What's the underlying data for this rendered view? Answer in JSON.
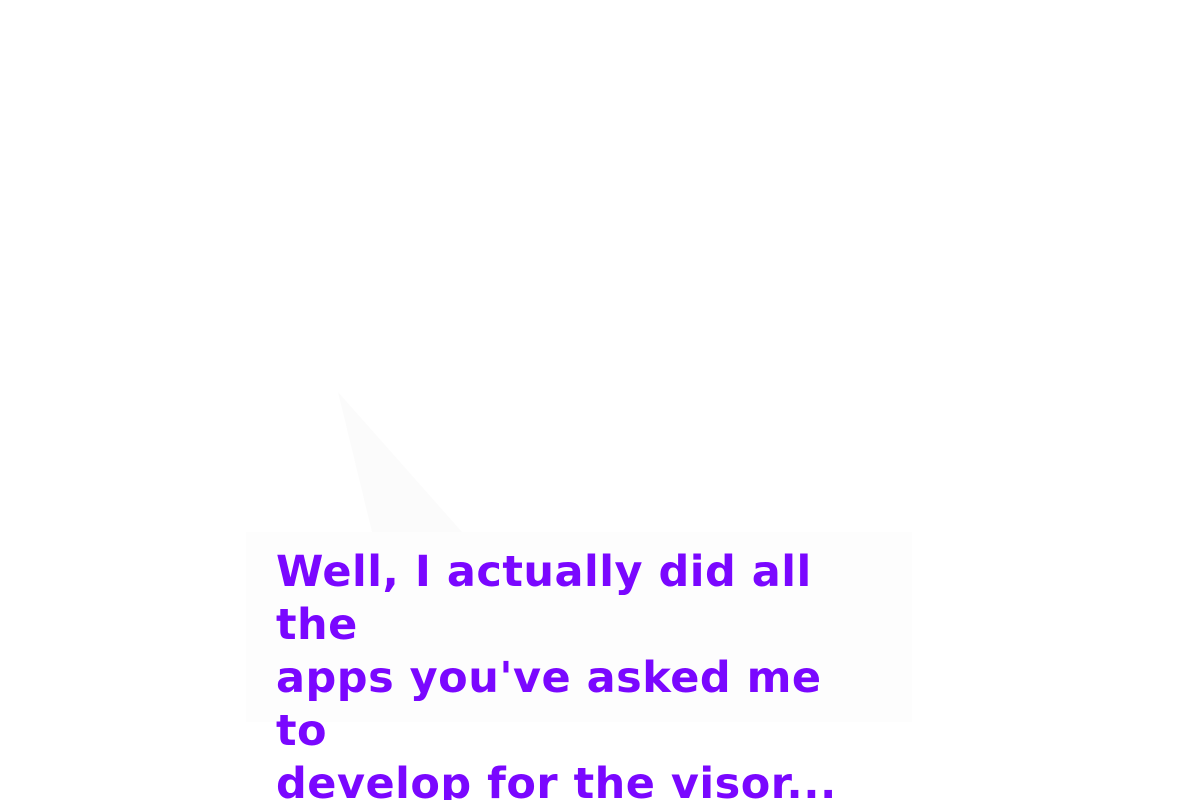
{
  "dialogue": {
    "text": "Well, I actually did all the\napps you've asked me to\ndevelop for the visor..."
  },
  "colors": {
    "text": "#7a07ff",
    "box": "#fdfdfd",
    "background": "#ffffff"
  }
}
